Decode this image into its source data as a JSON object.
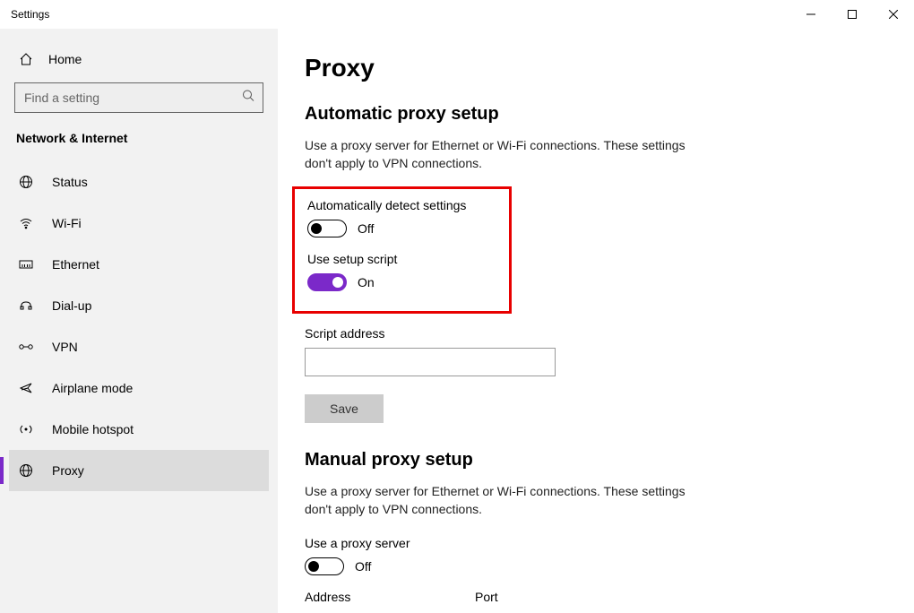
{
  "window": {
    "title": "Settings"
  },
  "sidebar": {
    "home": "Home",
    "search_placeholder": "Find a setting",
    "section": "Network & Internet",
    "items": [
      {
        "label": "Status"
      },
      {
        "label": "Wi-Fi"
      },
      {
        "label": "Ethernet"
      },
      {
        "label": "Dial-up"
      },
      {
        "label": "VPN"
      },
      {
        "label": "Airplane mode"
      },
      {
        "label": "Mobile hotspot"
      },
      {
        "label": "Proxy"
      }
    ]
  },
  "main": {
    "title": "Proxy",
    "auto": {
      "heading": "Automatic proxy setup",
      "desc": "Use a proxy server for Ethernet or Wi-Fi connections. These settings don't apply to VPN connections.",
      "detect_label": "Automatically detect settings",
      "detect_state": "Off",
      "script_label": "Use setup script",
      "script_state": "On",
      "addr_label": "Script address",
      "addr_value": "",
      "save": "Save"
    },
    "manual": {
      "heading": "Manual proxy setup",
      "desc": "Use a proxy server for Ethernet or Wi-Fi connections. These settings don't apply to VPN connections.",
      "use_label": "Use a proxy server",
      "use_state": "Off",
      "addr_label": "Address",
      "port_label": "Port"
    }
  }
}
